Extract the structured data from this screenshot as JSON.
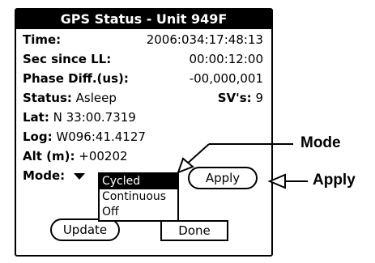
{
  "window": {
    "title": "GPS Status - Unit 949F"
  },
  "fields": {
    "time": {
      "label": "Time:",
      "value": "2006:034:17:48:13"
    },
    "sec_since_ll": {
      "label": "Sec since LL:",
      "value": "00:00:12:00"
    },
    "phase_diff": {
      "label": "Phase Diff.(us):",
      "value": "-00,000,001"
    },
    "status": {
      "label": "Status:",
      "value": "Asleep"
    },
    "svs": {
      "label": "SV's:",
      "value": "9"
    },
    "lat": {
      "label": "Lat:",
      "value": "N 33:00.7319"
    },
    "log": {
      "label": "Log:",
      "value": "W096:41.4127"
    },
    "alt": {
      "label": "Alt (m):",
      "value": "+00202"
    },
    "mode": {
      "label": "Mode:"
    }
  },
  "mode_menu": {
    "options": [
      "Cycled",
      "Continuous",
      "Off"
    ],
    "selected": "Cycled"
  },
  "buttons": {
    "apply": "Apply",
    "update": "Update",
    "done": "Done"
  },
  "annotations": {
    "mode": "Mode",
    "apply": "Apply"
  }
}
